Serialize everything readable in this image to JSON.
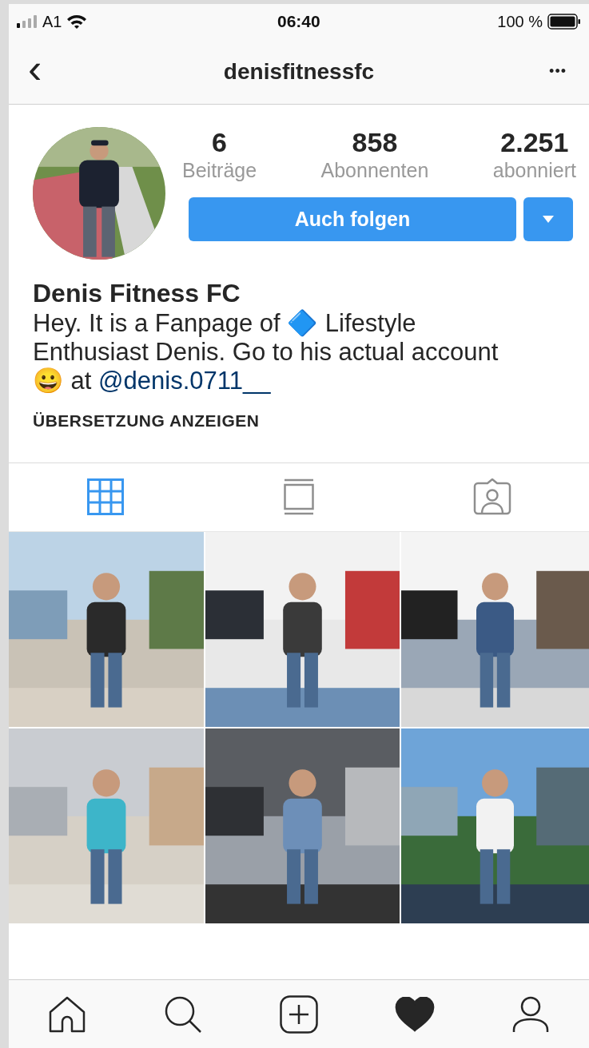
{
  "status_bar": {
    "carrier": "A1",
    "time": "06:40",
    "battery": "100 %"
  },
  "nav": {
    "back": "‹",
    "title": "denisfitnessfc",
    "more": "•••"
  },
  "profile": {
    "stats": [
      {
        "value": "6",
        "label": "Beiträge"
      },
      {
        "value": "858",
        "label": "Abonnenten"
      },
      {
        "value": "2.251",
        "label": "abonniert"
      }
    ],
    "follow_button": "Auch folgen",
    "name": "Denis Fitness FC",
    "bio": {
      "text": "Hey. It is a Fanpage of 🔷 Lifestyle Enthusiast Denis. Go to his actual account 😀 at ",
      "mention": "@denis.0711__"
    },
    "translate": "ÜBERSETZUNG ANZEIGEN"
  },
  "tabs": [
    {
      "kind": "grid",
      "selected": true
    },
    {
      "kind": "feed",
      "selected": false
    },
    {
      "kind": "tagged",
      "selected": false
    }
  ],
  "bottom_nav": [
    {
      "kind": "home",
      "selected": false
    },
    {
      "kind": "search",
      "selected": false
    },
    {
      "kind": "add",
      "selected": false
    },
    {
      "kind": "activity",
      "selected": true
    },
    {
      "kind": "profile",
      "selected": false
    }
  ]
}
